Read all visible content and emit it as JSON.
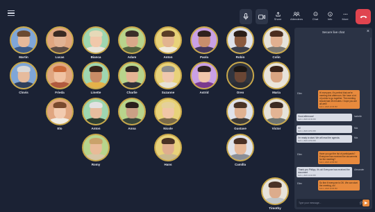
{
  "toolbar": {
    "share_label": "Share",
    "attendees_label": "Attendees",
    "chat_label": "Chat",
    "info_label": "Info",
    "more_label": "More"
  },
  "colors": {
    "background": "#1b2234",
    "avatar_ring": "#c9a84a",
    "hangup": "#e0444f",
    "own_message": "#e88a3d",
    "other_message": "#d8dce6"
  },
  "participants": [
    {
      "name": "Martin",
      "bg": "#7fa6d8",
      "skin": "#e6b99a",
      "hair": "#6b4a32",
      "shirt": "#3b5a88"
    },
    {
      "name": "Lucas",
      "bg": "#e0a680",
      "skin": "#e2b394",
      "hair": "#3a2a22",
      "shirt": "#5d4c44"
    },
    {
      "name": "Bianca",
      "bg": "#9fd6b0",
      "skin": "#f0c8aa",
      "hair": "#e6d9b8",
      "shirt": "#e9e5da"
    },
    {
      "name": "Adam",
      "bg": "#b8d48c",
      "skin": "#d9a98a",
      "hair": "#3b2e28",
      "shirt": "#54633f"
    },
    {
      "name": "Anton",
      "bg": "#e8d27a",
      "skin": "#e2b48f",
      "hair": "#5a3c26",
      "shirt": "#f0eadc"
    },
    {
      "name": "Paola",
      "bg": "#c9a0e6",
      "skin": "#c88e6c",
      "hair": "#2e211c",
      "shirt": "#43365a"
    },
    {
      "name": "Robin",
      "bg": "#dfe2ea",
      "skin": "#8a5a3e",
      "hair": "#2a1e18",
      "shirt": "#3b3e4a"
    },
    {
      "name": "Colin",
      "bg": "#e7e3da",
      "skin": "#e0b090",
      "hair": "#4a2e20",
      "shirt": "#7a7770"
    },
    {
      "name": "Clovis",
      "bg": "#7fa6d8",
      "skin": "#e6bb9d",
      "hair": "#d9d9d9",
      "shirt": "#2f3f5c"
    },
    {
      "name": "Frieda",
      "bg": "#e0a680",
      "skin": "#f0c2a2",
      "hair": "#c96a3a",
      "shirt": "#b05a3e"
    },
    {
      "name": "Linette",
      "bg": "#9fd6b0",
      "skin": "#c98c66",
      "hair": "#3a261c",
      "shirt": "#e4b24a"
    },
    {
      "name": "Charlie",
      "bg": "#b8d48c",
      "skin": "#e4b494",
      "hair": "#2e2824",
      "shirt": "#2e3038"
    },
    {
      "name": "Suzanne",
      "bg": "#e8d27a",
      "skin": "#efc8ae",
      "hair": "#8d8d8d",
      "shirt": "#e7e2d6"
    },
    {
      "name": "Astrid",
      "bg": "#c9a0e6",
      "skin": "#f0c6aa",
      "hair": "#2e2220",
      "shirt": "#7a3a8e"
    },
    {
      "name": "Oreo",
      "bg": "#30343e",
      "skin": "#6a4634",
      "hair": "#1a1614",
      "shirt": "#2a2c34"
    },
    {
      "name": "Maria",
      "bg": "#e7e3da",
      "skin": "#d9a582",
      "hair": "#3a241a",
      "shirt": "#ece6da"
    },
    {
      "name": "Elo",
      "bg": "#e0a680",
      "skin": "#f2cbb0",
      "hair": "#7a4a2e",
      "shirt": "#f0ece4"
    },
    {
      "name": "Anton",
      "bg": "#9fd6b0",
      "skin": "#e6bd9f",
      "hair": "#e2e2e2",
      "shirt": "#2e3e30"
    },
    {
      "name": "Anna",
      "bg": "#b8d48c",
      "skin": "#caa085",
      "hair": "#2a201c",
      "shirt": "#39463a"
    },
    {
      "name": "Nicole",
      "bg": "#e8d27a",
      "skin": "#f0c6a6",
      "hair": "#e4d09a",
      "shirt": "#7a6a4a"
    },
    {
      "name": "Gustave",
      "bg": "#dfe2ea",
      "skin": "#e0b292",
      "hair": "#4a3426",
      "shirt": "#3c3a38"
    },
    {
      "name": "Victor",
      "bg": "#e7e3da",
      "skin": "#e2b494",
      "hair": "#3a2a22",
      "shirt": "#6e7470"
    },
    {
      "name": "Romy",
      "bg": "#b8d48c",
      "skin": "#e8bb98",
      "hair": "#c9a26a",
      "shirt": "#d6c6a6"
    },
    {
      "name": "Hans",
      "bg": "#e8d27a",
      "skin": "#dfae8e",
      "hair": "#4a3224",
      "shirt": "#c9b98e"
    },
    {
      "name": "Camilla",
      "bg": "#dfe2ea",
      "skin": "#e6b898",
      "hair": "#4a3024",
      "shirt": "#8a8e96"
    },
    {
      "name": "Timothy",
      "bg": "#e7e3da",
      "skin": "#dcac8c",
      "hair": "#4a3226",
      "shirt": "#c0c6c8"
    }
  ],
  "chat": {
    "title": "Secure live chat",
    "input_placeholder": "Type your message...",
    "messages": [
      {
        "sender": "Ellen",
        "direction": "out",
        "text": "Hi everyone, it's perfect that we're meeting this afternoon. We have a lot of points to go together. The meeting should last 45 minutes. I hope you are all well!",
        "time": "Feb 1, 2023 13:45 PM"
      },
      {
        "sender": "Isabelle",
        "direction": "in",
        "text": "Good afternoon!",
        "time": "Feb 1, 2023 13:49 PM"
      },
      {
        "sender": "Mia",
        "direction": "in",
        "text": "Hi!",
        "time": "Feb 1, 2023 13:51 PM"
      },
      {
        "sender": "Mia",
        "direction": "in",
        "text": "I'm ready to start. We will read the agenda.",
        "time": "Feb 1, 2023 13:53 PM"
      },
      {
        "sender": "Ellen",
        "direction": "out",
        "text": "Have you got the list of participants? Everyone has received the documents for the meeting?",
        "time": "Feb 1, 2023 13:58 PM"
      },
      {
        "sender": "Alexander",
        "direction": "in",
        "text": "Thank you Philipp, it's ok! Everyone has received the document",
        "time": "Feb 1, 2023 14:02 PM"
      },
      {
        "sender": "Ellen",
        "direction": "out",
        "text": "So fine if everyone is OK. We can start the meeting, ok!",
        "time": "Feb 1, 2023 14:05 PM"
      }
    ]
  }
}
